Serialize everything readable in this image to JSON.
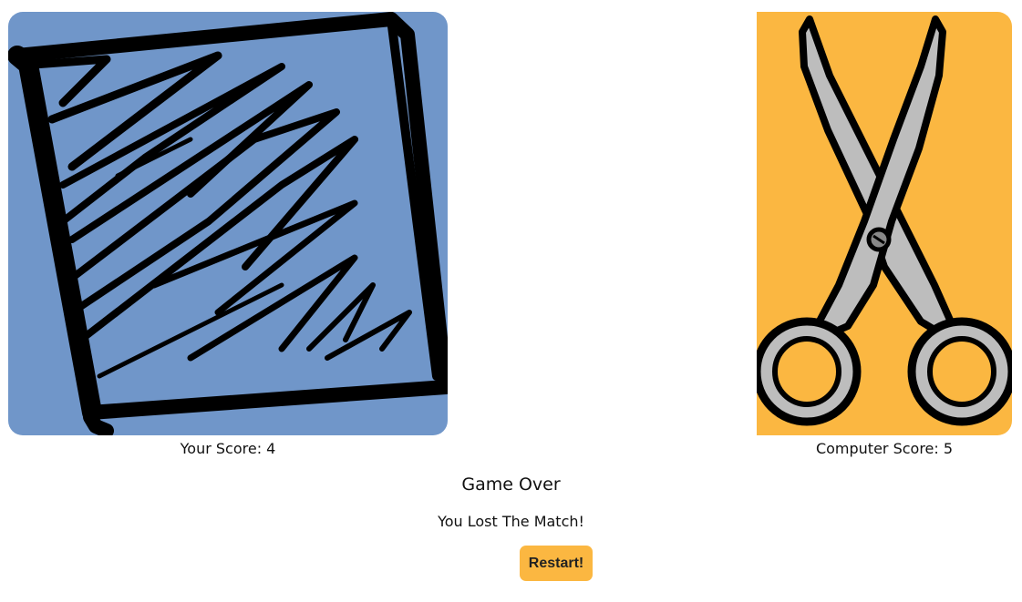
{
  "player": {
    "choice": "paper",
    "icon": "paper-icon",
    "score_label": "Your Score: 4",
    "score": 4,
    "card_color": "#7096c9"
  },
  "computer": {
    "choice": "scissors",
    "icon": "scissors-icon",
    "score_label": "Computer Score: 5",
    "score": 5,
    "card_color": "#fbb741"
  },
  "status": {
    "title": "Game Over",
    "message": "You Lost The Match!"
  },
  "actions": {
    "restart_label": "Restart!",
    "restart_color": "#fbb741"
  }
}
